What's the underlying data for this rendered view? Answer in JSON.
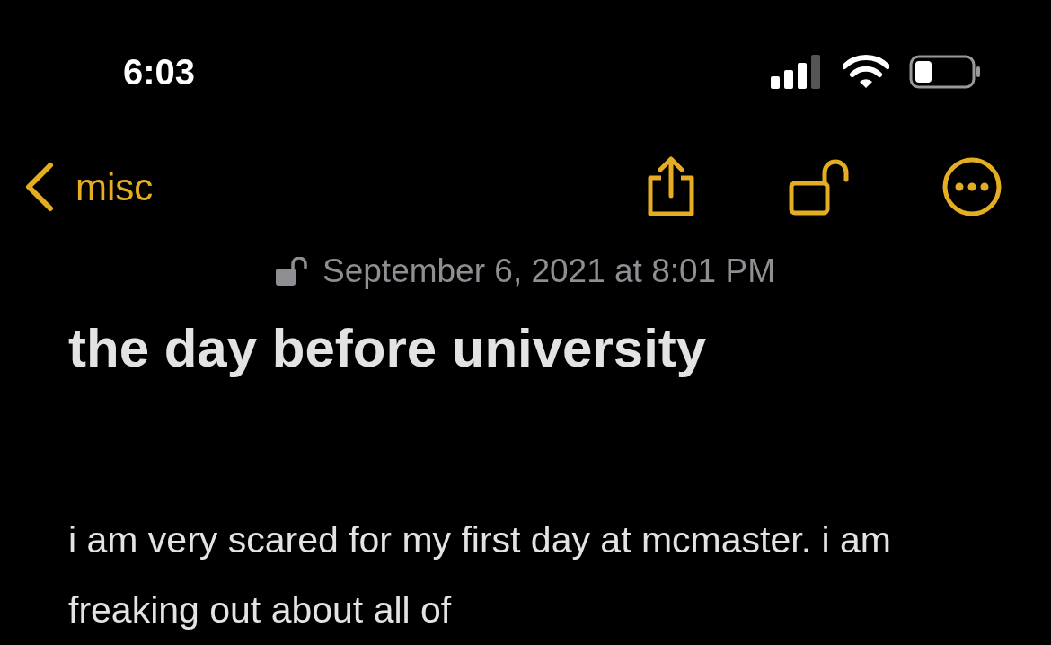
{
  "status_bar": {
    "time": "6:03"
  },
  "nav": {
    "back_label": "misc"
  },
  "note": {
    "date": "September 6, 2021 at 8:01 PM",
    "title": "the day before university",
    "body": "i am very scared for my first day at mcmaster. i am freaking out about all of"
  }
}
